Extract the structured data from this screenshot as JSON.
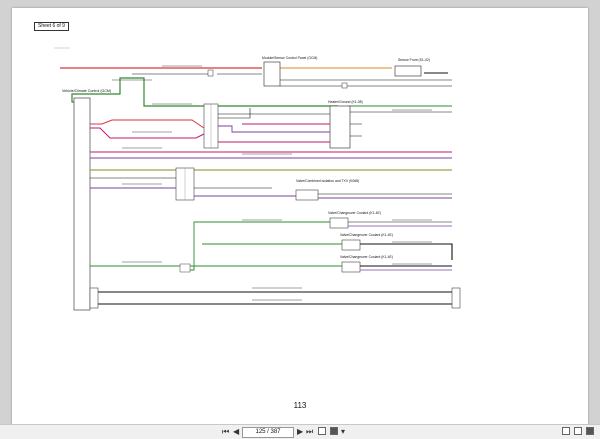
{
  "document": {
    "sheet_label": "Sheet 6 of 9",
    "page_number": "113"
  },
  "components": {
    "left_module": "Vehicle/Climate Control (GCM)",
    "top_module": "Module/Sensor Control Panel (GCM)",
    "sensor_right": "Sensor Front (S1-02)",
    "heater_control": "Heater/Ground (K1-08)",
    "valve_combined": "Valve/Combined isolation and TXV (K068)",
    "valve_1": "Valve/Changeover Coolant (K1-4E)",
    "valve_2": "Valve/Changeover Coolant (K1-4E)",
    "valve_3": "Valve/Changeover Coolant (K1-4E)"
  },
  "colors": {
    "red": "#d9363e",
    "green": "#2e8b2e",
    "pink": "#c2186b",
    "purple": "#7b3fa0",
    "orange": "#e08a1e",
    "olive": "#8a8a1a",
    "black": "#111111",
    "grey": "#666666"
  },
  "toolbar": {
    "first_page": "⏮",
    "prev_page": "◀",
    "page_field": "125 / 387",
    "next_page": "▶",
    "last_page": "⏭",
    "dropdown": "▾"
  }
}
